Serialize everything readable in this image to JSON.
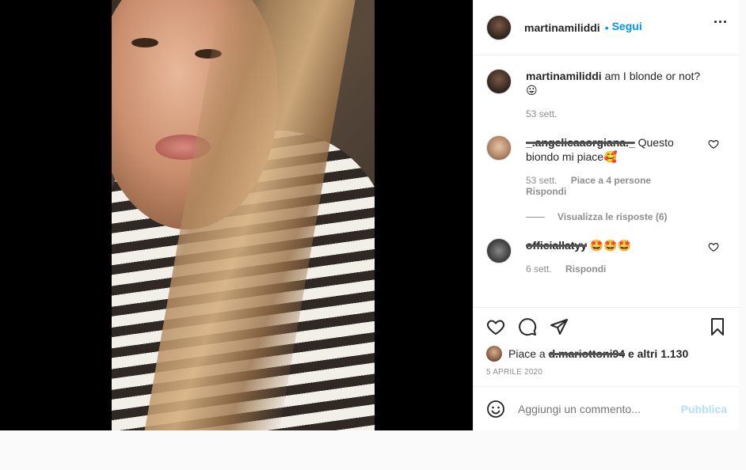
{
  "post": {
    "author": "martinamiliddi",
    "follow_label": "Segui",
    "caption": "am I blonde or not? 😛",
    "caption_time": "53 sett."
  },
  "comments": [
    {
      "username": "_.angelicaaorgiana._",
      "text": "Questo biondo mi piace🥰",
      "time": "53 sett.",
      "likes": "Piace a 4 persone",
      "reply_label": "Rispondi",
      "view_replies": "Visualizza le risposte (6)"
    },
    {
      "username": "officiallatyy",
      "text": "🤩🤩🤩",
      "time": "6 sett.",
      "reply_label": "Rispondi"
    }
  ],
  "likes": {
    "prefix": "Piace a",
    "user": "d.mariottoni94",
    "suffix": "e altri 1.130"
  },
  "date": "5 APRILE 2020",
  "add_comment": {
    "placeholder": "Aggiungi un commento...",
    "publish_label": "Pubblica"
  },
  "icons": [
    "heart-icon",
    "comment-icon",
    "share-icon",
    "save-icon",
    "emoji-icon",
    "more-icon"
  ]
}
